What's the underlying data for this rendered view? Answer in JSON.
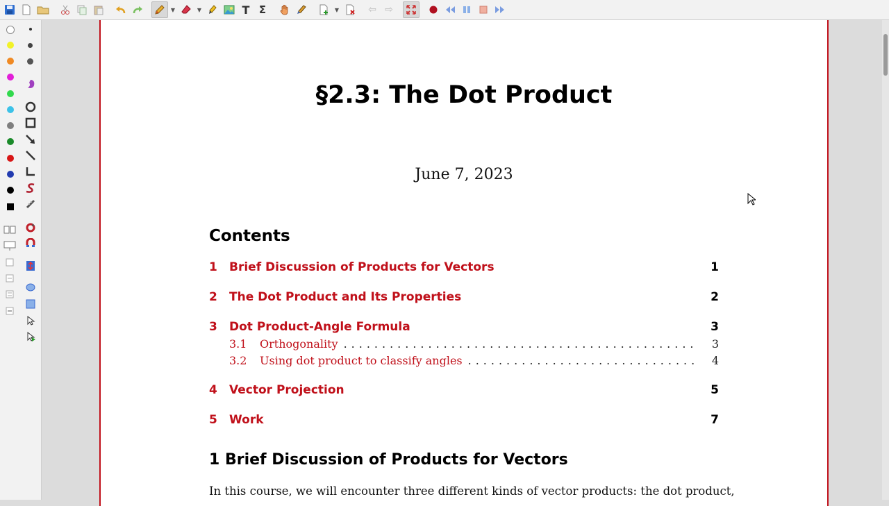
{
  "toolbar": {
    "icons": [
      "save-icon",
      "new-page-icon",
      "open-folder-icon",
      "cut-icon",
      "copy-icon",
      "paste-icon",
      "undo-icon",
      "redo-icon",
      "pen-icon",
      "eraser-icon",
      "highlighter-icon",
      "image-icon",
      "text-icon",
      "latex-icon",
      "hand-icon",
      "select-region-icon",
      "add-page-icon",
      "delete-page-icon",
      "previous-page-icon",
      "next-page-icon",
      "fullscreen-icon",
      "record-icon",
      "rewind-icon",
      "pause-icon",
      "stop-icon",
      "fast-forward-icon"
    ]
  },
  "sidebar": {
    "colors": [
      "#ffffff",
      "#f2f228",
      "#f08a24",
      "#e21fd8",
      "#31d94d",
      "#3cc2e8",
      "#7f7f7f",
      "#1a8a2a",
      "#d81616",
      "#233cb0",
      "#000000"
    ],
    "accent": "#c0101a"
  },
  "document": {
    "title": "§2.3:  The Dot Product",
    "date": "June 7, 2023",
    "contents_heading": "Contents",
    "toc": [
      {
        "num": "1",
        "title": "Brief Discussion of Products for Vectors",
        "page": "1"
      },
      {
        "num": "2",
        "title": "The Dot Product and Its Properties",
        "page": "2"
      },
      {
        "num": "3",
        "title": "Dot Product-Angle Formula",
        "page": "3"
      },
      {
        "num": "4",
        "title": "Vector Projection",
        "page": "5"
      },
      {
        "num": "5",
        "title": "Work",
        "page": "7"
      }
    ],
    "subtoc": [
      {
        "num": "3.1",
        "title": "Orthogonality",
        "page": "3"
      },
      {
        "num": "3.2",
        "title": "Using dot product to classify angles",
        "page": "4"
      }
    ],
    "section_heading": "1   Brief Discussion of Products for Vectors",
    "paragraph": "In this course, we will encounter three different kinds of vector products:  the dot product,"
  }
}
